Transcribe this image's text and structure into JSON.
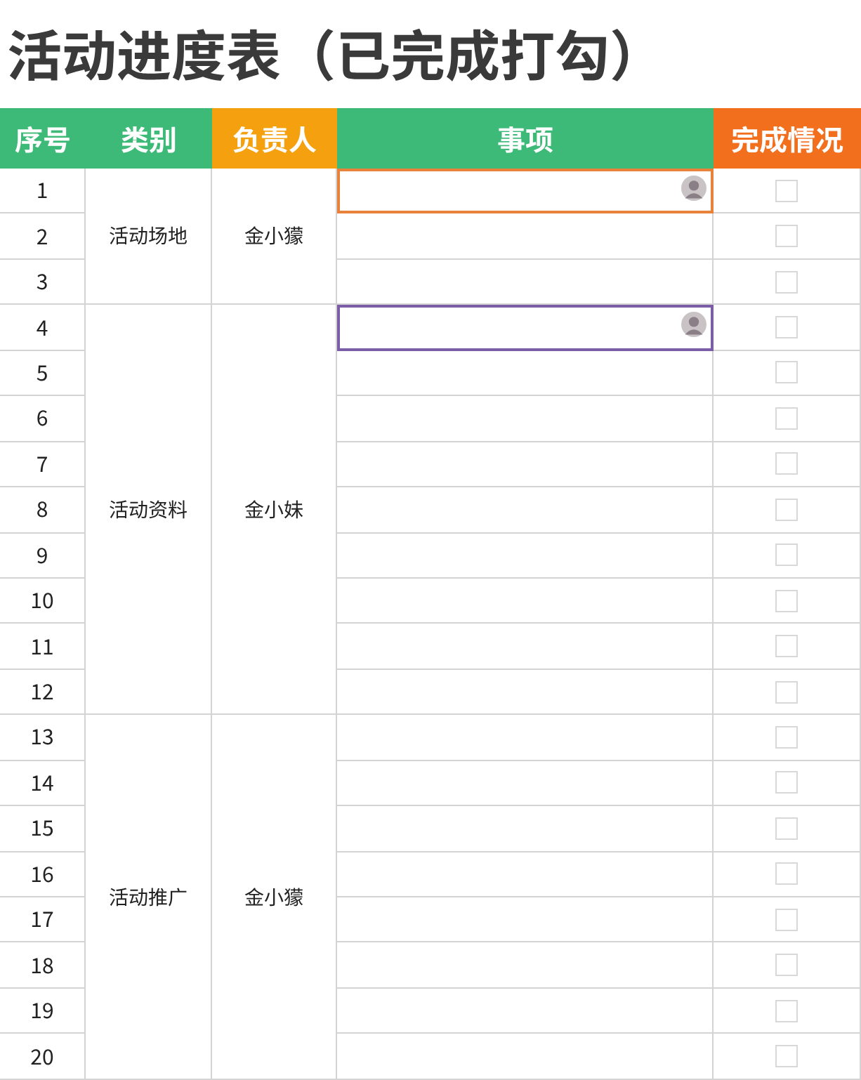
{
  "title": "活动进度表（已完成打勾）",
  "columns": [
    {
      "label": "序号",
      "color": "#3dba78"
    },
    {
      "label": "类别",
      "color": "#3dba78"
    },
    {
      "label": "负责人",
      "color": "#f5a10f"
    },
    {
      "label": "事项",
      "color": "#3dba78"
    },
    {
      "label": "完成情况",
      "color": "#f26f1e"
    }
  ],
  "groups": [
    {
      "category": "活动场地",
      "owner": "金小獴",
      "rows": [
        {
          "number": "1",
          "checked": false,
          "color": "#e8823a"
        },
        {
          "number": "2",
          "checked": false
        },
        {
          "number": "3",
          "checked": false
        }
      ]
    },
    {
      "category": "活动资料",
      "owner": "金小妹",
      "rows": [
        {
          "number": "4",
          "checked": false,
          "color": "#7b5ea7"
        },
        {
          "number": "5",
          "checked": false
        },
        {
          "number": "6",
          "checked": false
        },
        {
          "number": "7",
          "checked": false
        },
        {
          "number": "8",
          "checked": false
        },
        {
          "number": "9",
          "checked": false
        },
        {
          "number": "10",
          "checked": false
        },
        {
          "number": "11",
          "checked": false
        },
        {
          "number": "12",
          "checked": false
        }
      ]
    },
    {
      "category": "活动推广",
      "owner": "金小獴",
      "rows": [
        {
          "number": "13",
          "checked": false
        },
        {
          "number": "14",
          "checked": false
        },
        {
          "number": "15",
          "checked": false
        },
        {
          "number": "16",
          "checked": false
        },
        {
          "number": "17",
          "checked": false
        },
        {
          "number": "18",
          "checked": false
        },
        {
          "number": "19",
          "checked": false
        },
        {
          "number": "20",
          "checked": false
        }
      ]
    }
  ]
}
